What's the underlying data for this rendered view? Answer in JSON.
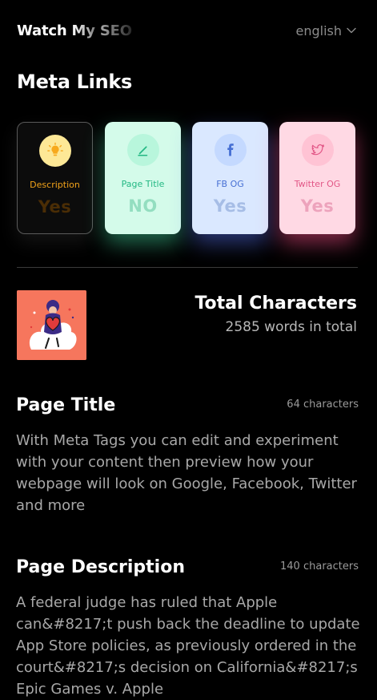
{
  "header": {
    "logo_main": "Watch ",
    "logo_fade": "My ",
    "logo_seo": "SEO",
    "language": "english",
    "language_icon": "chevron-down-icon"
  },
  "meta_links": {
    "title": "Meta Links",
    "cards": [
      {
        "label": "Description",
        "value": "Yes",
        "icon": "lightbulb-icon",
        "accent": "#f2a31a"
      },
      {
        "label": "Page Title",
        "value": "NO",
        "icon": "pen-icon",
        "accent": "#23b883"
      },
      {
        "label": "FB OG",
        "value": "Yes",
        "icon": "facebook-icon",
        "accent": "#4770d4"
      },
      {
        "label": "Twitter OG",
        "value": "Yes",
        "icon": "twitter-icon",
        "accent": "#e25686"
      }
    ]
  },
  "total": {
    "title": "Total Characters",
    "subtitle": "2585 words in total"
  },
  "page_title": {
    "heading": "Page Title",
    "count": "64 characters",
    "text": "With Meta Tags you can edit and experiment with your content then preview how your webpage will look on Google, Facebook, Twitter and more"
  },
  "page_description": {
    "heading": "Page Description",
    "count": "140 characters",
    "text": "A federal judge has ruled that Apple can&#8217;t push back the deadline to update App Store policies, as previously ordered in the court&#8217;s decision on California&#8217;s Epic Games v. Apple"
  }
}
